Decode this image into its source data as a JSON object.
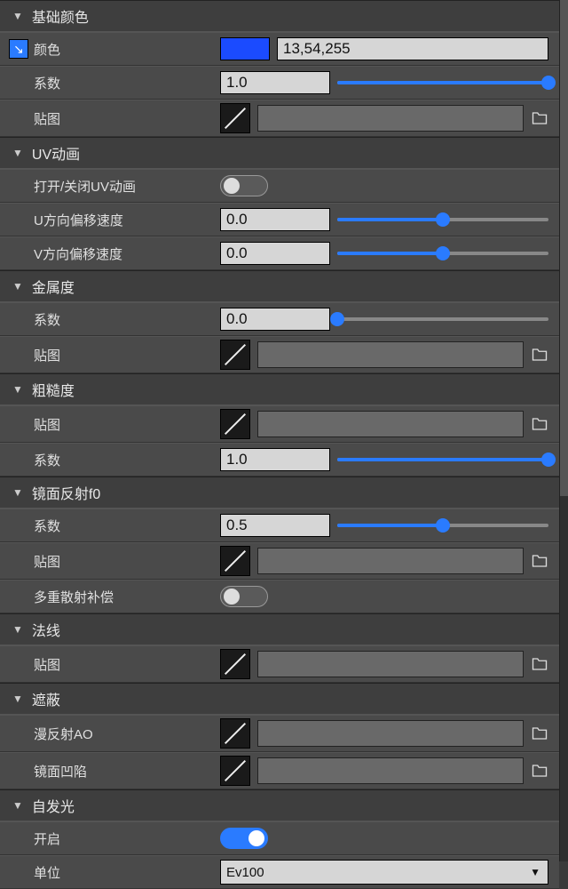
{
  "sections": {
    "baseColor": {
      "title": "基础颜色",
      "color_label": "颜色",
      "color_value": "13,54,255",
      "color_hex": "#1b4bff",
      "coeff_label": "系数",
      "coeff_value": "1.0",
      "coeff_pct": 100,
      "tex_label": "贴图"
    },
    "uvAnim": {
      "title": "UV动画",
      "toggle_label": "打开/关闭UV动画",
      "toggle_on": false,
      "u_label": "U方向偏移速度",
      "u_value": "0.0",
      "u_pct": 50,
      "v_label": "V方向偏移速度",
      "v_value": "0.0",
      "v_pct": 50
    },
    "metallic": {
      "title": "金属度",
      "coeff_label": "系数",
      "coeff_value": "0.0",
      "coeff_pct": 0,
      "tex_label": "贴图"
    },
    "roughness": {
      "title": "粗糙度",
      "tex_label": "贴图",
      "coeff_label": "系数",
      "coeff_value": "1.0",
      "coeff_pct": 100
    },
    "specularF0": {
      "title": "镜面反射f0",
      "coeff_label": "系数",
      "coeff_value": "0.5",
      "coeff_pct": 50,
      "tex_label": "贴图",
      "ms_label": "多重散射补偿",
      "ms_on": false
    },
    "normal": {
      "title": "法线",
      "tex_label": "贴图"
    },
    "occlusion": {
      "title": "遮蔽",
      "diffuse_ao_label": "漫反射AO",
      "spec_cavity_label": "镜面凹陷"
    },
    "emissive": {
      "title": "自发光",
      "enable_label": "开启",
      "enable_on": true,
      "unit_label": "单位",
      "unit_value": "Ev100"
    }
  }
}
